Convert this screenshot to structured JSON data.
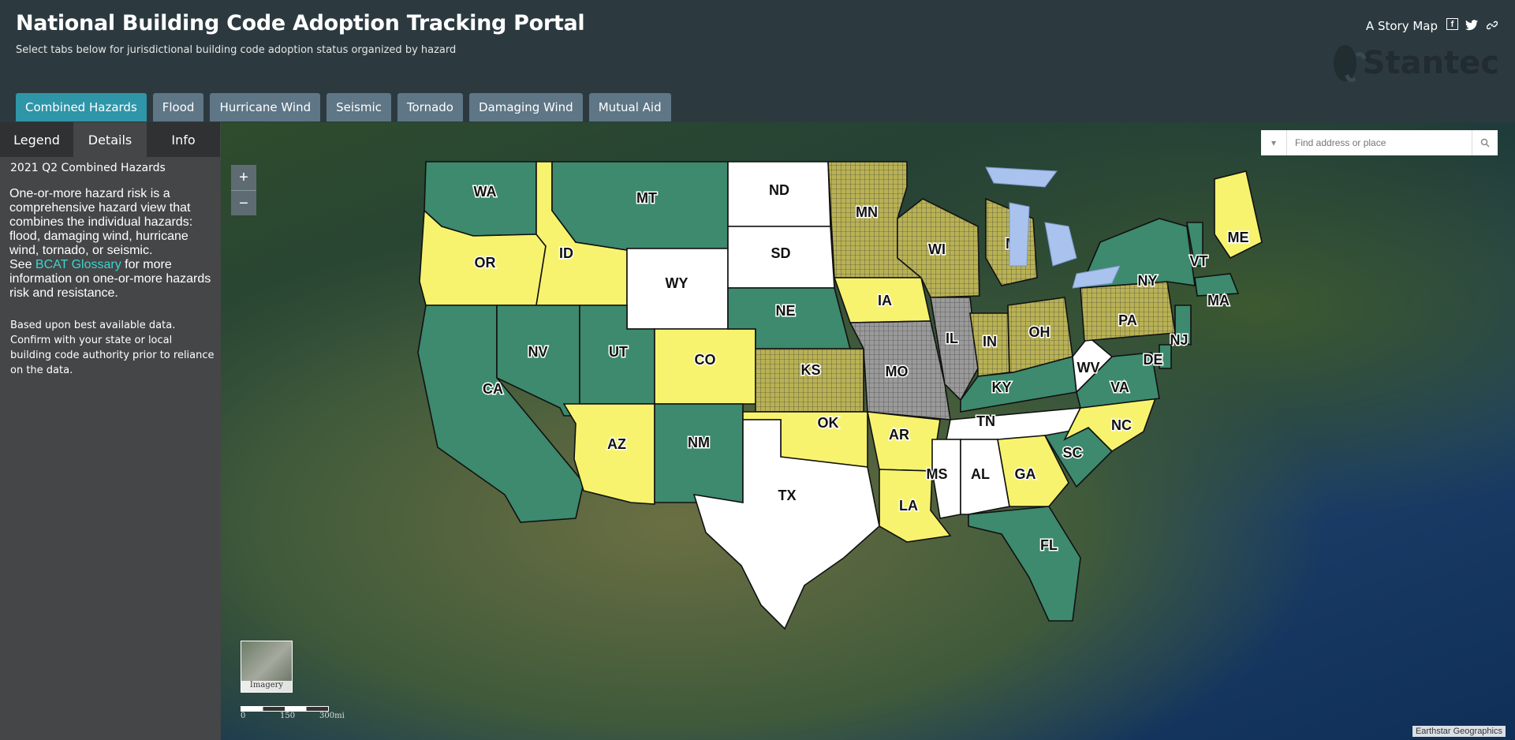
{
  "header": {
    "title": "National Building Code Adoption Tracking Portal",
    "subtitle": "Select tabs below for jurisdictional building code adoption status organized by hazard",
    "story_map": "A Story Map",
    "logo_text": "Stantec"
  },
  "tabs": [
    "Combined Hazards",
    "Flood",
    "Hurricane Wind",
    "Seismic",
    "Tornado",
    "Damaging Wind",
    "Mutual Aid"
  ],
  "active_tab": 0,
  "panel": {
    "tabs": [
      "Legend",
      "Details",
      "Info"
    ],
    "active_tab": 1,
    "section_title": "2021 Q2 Combined Hazards",
    "description": "One-or-more hazard risk is a comprehensive hazard view that combines the individual hazards: flood, damaging wind, hurricane wind, tornado, or seismic.",
    "see": "See",
    "glossary_link": "BCAT Glossary",
    "see_after": "for more information on one-or-more hazards risk and resistance.",
    "note": "Based upon best available data. Confirm with your state or local building code authority prior to reliance on the data."
  },
  "map": {
    "search_placeholder": "Find address or place",
    "zoom_in": "+",
    "zoom_out": "−",
    "basemap_label": "Imagery",
    "scale_labels": [
      "0",
      "150",
      "300mi"
    ],
    "attribution": "Earthstar Geographics",
    "states": [
      "WA",
      "OR",
      "CA",
      "ID",
      "NV",
      "MT",
      "WY",
      "UT",
      "AZ",
      "CO",
      "NM",
      "ND",
      "SD",
      "NE",
      "KS",
      "OK",
      "TX",
      "MN",
      "IA",
      "MO",
      "AR",
      "LA",
      "WI",
      "IL",
      "MI",
      "IN",
      "OH",
      "KY",
      "TN",
      "MS",
      "AL",
      "GA",
      "FL",
      "SC",
      "NC",
      "VA",
      "WV",
      "PA",
      "NY",
      "NJ",
      "DE",
      "VT",
      "MA",
      "ME"
    ]
  },
  "colors": {
    "green": "#3d8a6e",
    "yellow": "#f7f36e",
    "olive": "#b9b255",
    "white": "#ffffff",
    "gray": "#9a9a9a",
    "tab_active": "#2f95a8",
    "tab": "#5e7686"
  }
}
